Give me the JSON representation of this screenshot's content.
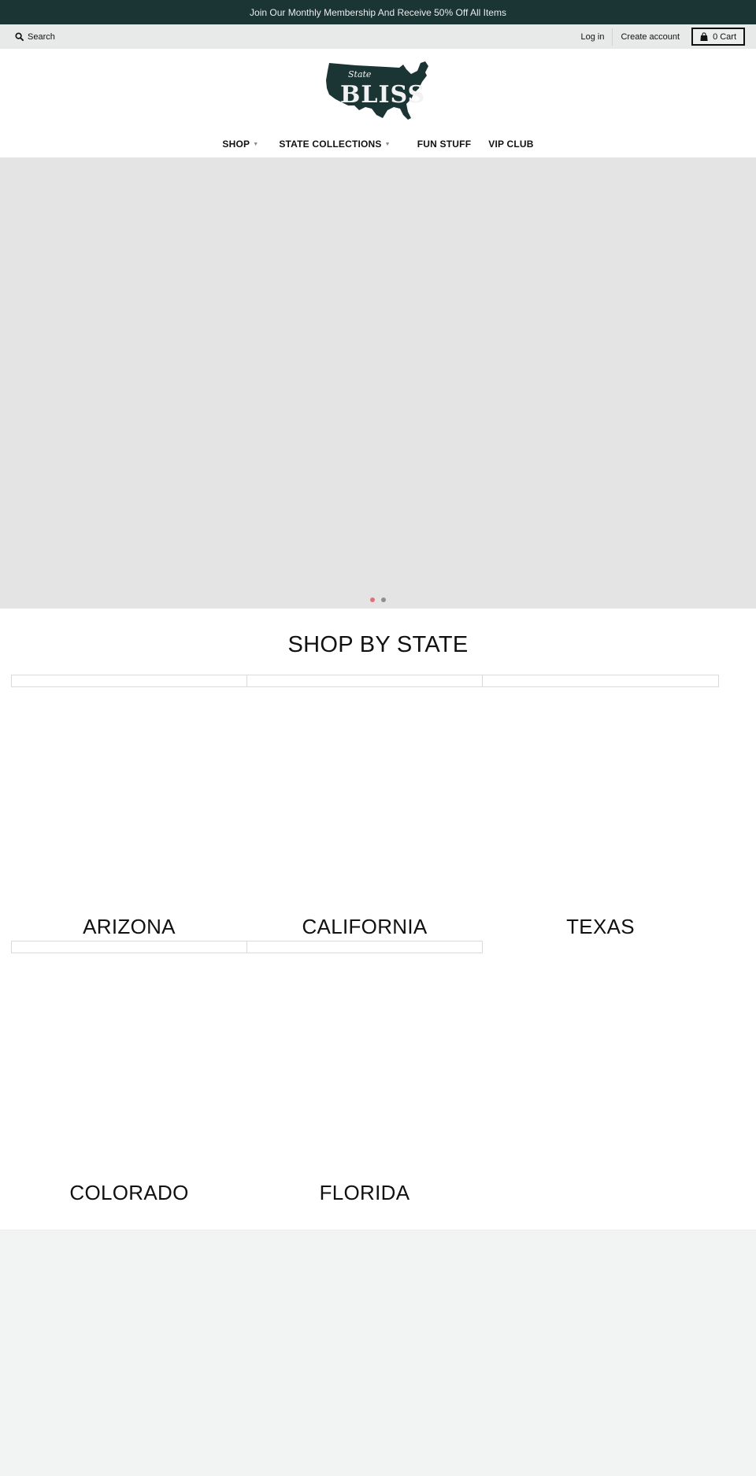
{
  "announcement": {
    "text": "Join Our Monthly Membership And Receive 50% Off All Items",
    "background": "#1b3434"
  },
  "utility_bar": {
    "search_label": "Search",
    "search_icon": "search-icon",
    "login_label": "Log in",
    "create_account_label": "Create account",
    "cart": {
      "count": "0",
      "label": "Cart",
      "icon": "shopping-bag-icon"
    }
  },
  "logo": {
    "brand_top": "State",
    "brand_main": "BLISS",
    "brand_color": "#1b3434"
  },
  "main_nav": {
    "items": [
      {
        "label": "SHOP",
        "has_dropdown": true
      },
      {
        "label": "STATE COLLECTIONS",
        "has_dropdown": true
      },
      {
        "label": "FUN STUFF",
        "has_dropdown": false
      },
      {
        "label": "VIP CLUB",
        "has_dropdown": false
      }
    ],
    "caret_glyph": "▼"
  },
  "hero": {
    "slides": 2,
    "active_slide": 1,
    "dot_active_color": "#e2707a",
    "dot_inactive_color": "#8f8f8f"
  },
  "shop_by_state": {
    "title": "SHOP BY STATE",
    "states": [
      {
        "label": "ARIZONA"
      },
      {
        "label": "CALIFORNIA"
      },
      {
        "label": "TEXAS"
      },
      {
        "label": "COLORADO"
      },
      {
        "label": "FLORIDA"
      }
    ]
  }
}
